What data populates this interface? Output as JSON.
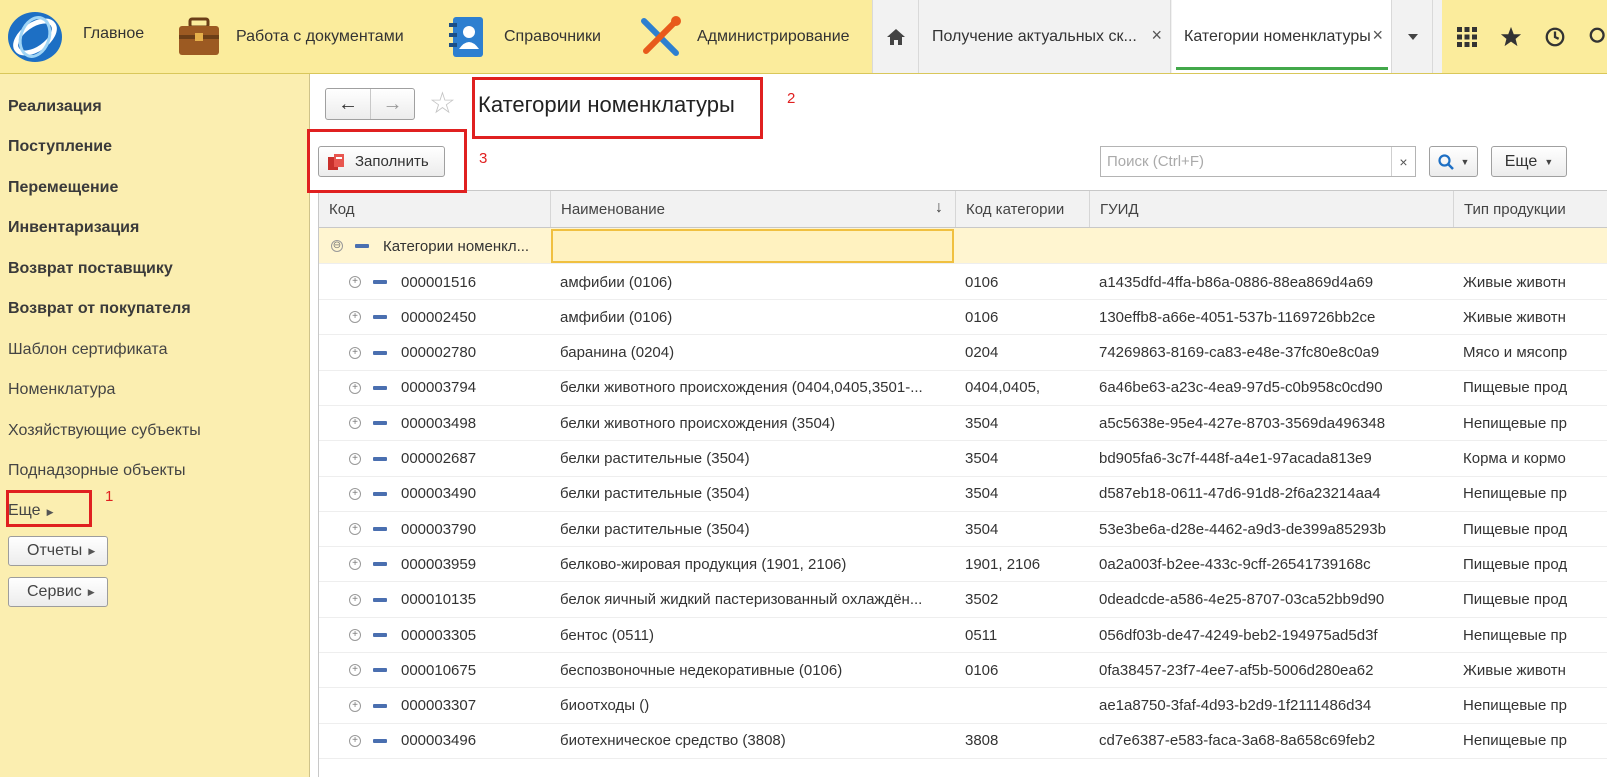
{
  "colors": {
    "topbar": "#fbec9c",
    "sidebar": "#fbeeb0",
    "accent_tab": "#42a84a",
    "annotation": "#e02020",
    "group_row": "#fff5d0"
  },
  "topbar": {
    "sections": [
      {
        "label": "Главное",
        "icon": "app-logo-icon"
      },
      {
        "label": "Работа с документами",
        "icon": "briefcase-icon"
      },
      {
        "label": "Справочники",
        "icon": "address-book-icon"
      },
      {
        "label": "Администрирование",
        "icon": "tools-icon"
      }
    ],
    "tabs": [
      {
        "label": "Получение актуальных ск...",
        "close": "×"
      },
      {
        "label": "Категории номенклатуры",
        "close": "×"
      }
    ],
    "icons": [
      "home-icon",
      "chevron-down-icon",
      "grid-icon",
      "star-icon",
      "history-icon"
    ]
  },
  "sidebar": {
    "items": [
      {
        "label": "Реализация"
      },
      {
        "label": "Поступление"
      },
      {
        "label": "Перемещение"
      },
      {
        "label": "Инвентаризация"
      },
      {
        "label": "Возврат поставщику"
      },
      {
        "label": "Возврат от покупателя"
      },
      {
        "label": "Шаблон сертификата"
      },
      {
        "label": "Номенклатура"
      },
      {
        "label": "Хозяйствующие субъекты"
      },
      {
        "label": "Поднадзорные объекты"
      }
    ],
    "more_label": "Еще",
    "buttons": [
      {
        "label": "Отчеты"
      },
      {
        "label": "Сервис"
      }
    ]
  },
  "form": {
    "title": "Категории номенклатуры",
    "fill_button": "Заполнить",
    "search_placeholder": "Поиск (Ctrl+F)",
    "search_clear": "×",
    "more_button": "Еще"
  },
  "annotations": {
    "n1": "1",
    "n2": "2",
    "n3": "3"
  },
  "table": {
    "columns": [
      "Код",
      "Наименование",
      "Код категории",
      "ГУИД",
      "Тип продукции"
    ],
    "sort_indicator": "↓",
    "group_row": {
      "code": "Категории номенкл...",
      "expand": "⊖"
    },
    "rows": [
      {
        "code": "000001516",
        "name": "амфибии (0106)",
        "cat": "0106",
        "guid": "a1435dfd-4ffa-b86a-0886-88ea869d4a69",
        "type": "Живые животн"
      },
      {
        "code": "000002450",
        "name": "амфибии (0106)",
        "cat": "0106",
        "guid": "130effb8-a66e-4051-537b-1169726bb2ce",
        "type": "Живые животн"
      },
      {
        "code": "000002780",
        "name": "баранина (0204)",
        "cat": "0204",
        "guid": "74269863-8169-ca83-e48e-37fc80e8c0a9",
        "type": "Мясо и мясопр"
      },
      {
        "code": "000003794",
        "name": "белки животного происхождения (0404,0405,3501-...",
        "cat": "0404,0405,",
        "guid": "6a46be63-a23c-4ea9-97d5-c0b958c0cd90",
        "type": "Пищевые прод"
      },
      {
        "code": "000003498",
        "name": "белки животного происхождения (3504)",
        "cat": "3504",
        "guid": "a5c5638e-95e4-427e-8703-3569da496348",
        "type": "Непищевые пр"
      },
      {
        "code": "000002687",
        "name": "белки растительные (3504)",
        "cat": "3504",
        "guid": "bd905fa6-3c7f-448f-a4e1-97acada813e9",
        "type": "Корма и кормо"
      },
      {
        "code": "000003490",
        "name": "белки растительные (3504)",
        "cat": "3504",
        "guid": "d587eb18-0611-47d6-91d8-2f6a23214aa4",
        "type": "Непищевые пр"
      },
      {
        "code": "000003790",
        "name": "белки растительные (3504)",
        "cat": "3504",
        "guid": "53e3be6a-d28e-4462-a9d3-de399a85293b",
        "type": "Пищевые прод"
      },
      {
        "code": "000003959",
        "name": "белково-жировая продукция (1901, 2106)",
        "cat": "1901, 2106",
        "guid": "0a2a003f-b2ee-433c-9cff-26541739168c",
        "type": "Пищевые прод"
      },
      {
        "code": "000010135",
        "name": "белок яичный жидкий пастеризованный охлаждён...",
        "cat": "3502",
        "guid": "0deadcde-a586-4e25-8707-03ca52bb9d90",
        "type": "Пищевые прод"
      },
      {
        "code": "000003305",
        "name": "бентос (0511)",
        "cat": "0511",
        "guid": "056df03b-de47-4249-beb2-194975ad5d3f",
        "type": "Непищевые пр"
      },
      {
        "code": "000010675",
        "name": "беспозвоночные недекоративные (0106)",
        "cat": "0106",
        "guid": "0fa38457-23f7-4ee7-af5b-5006d280ea62",
        "type": "Живые животн"
      },
      {
        "code": "000003307",
        "name": "биоотходы ()",
        "cat": "",
        "guid": "ae1a8750-3faf-4d93-b2d9-1f2111486d34",
        "type": "Непищевые пр"
      },
      {
        "code": "000003496",
        "name": "биотехническое средство (3808)",
        "cat": "3808",
        "guid": "cd7e6387-e583-faca-3a68-8a658c69feb2",
        "type": "Непищевые пр"
      }
    ]
  }
}
